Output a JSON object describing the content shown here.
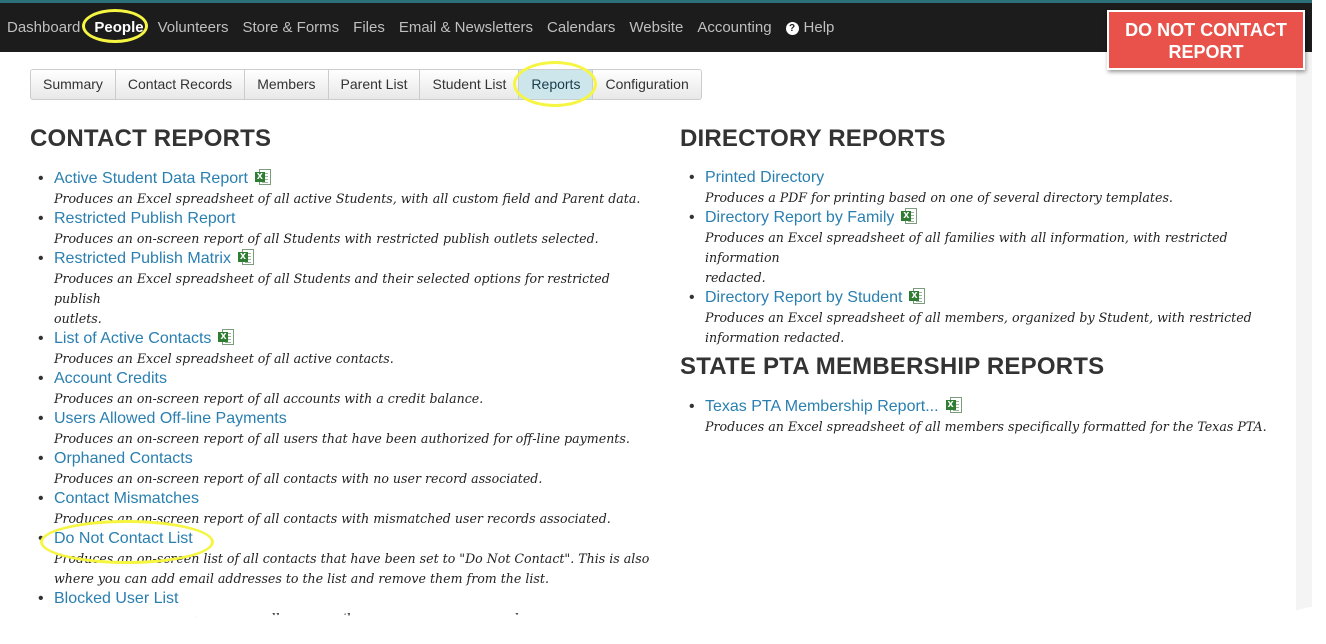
{
  "callout": {
    "line1": "DO NOT CONTACT",
    "line2": "REPORT"
  },
  "top_nav": [
    {
      "label": "Dashboard"
    },
    {
      "label": "People",
      "active": true
    },
    {
      "label": "Volunteers"
    },
    {
      "label": "Store & Forms"
    },
    {
      "label": "Files"
    },
    {
      "label": "Email & Newsletters"
    },
    {
      "label": "Calendars"
    },
    {
      "label": "Website"
    },
    {
      "label": "Accounting"
    },
    {
      "label": "Help",
      "icon": "question-circle-icon"
    }
  ],
  "tabs": [
    {
      "label": "Summary"
    },
    {
      "label": "Contact Records"
    },
    {
      "label": "Members"
    },
    {
      "label": "Parent List"
    },
    {
      "label": "Student List"
    },
    {
      "label": "Reports",
      "active": true
    },
    {
      "label": "Configuration"
    }
  ],
  "contact_reports": {
    "heading": "CONTACT REPORTS",
    "items": [
      {
        "label": "Active Student Data Report",
        "excel": true,
        "desc": [
          "Produces an Excel spreadsheet of all active Students, with all custom field and Parent data."
        ]
      },
      {
        "label": "Restricted Publish Report",
        "excel": false,
        "desc": [
          "Produces an on-screen report of all Students with restricted publish outlets selected."
        ]
      },
      {
        "label": "Restricted Publish Matrix",
        "excel": true,
        "desc": [
          "Produces an Excel spreadsheet of all Students and their selected options for restricted publish",
          "outlets."
        ]
      },
      {
        "label": "List of Active Contacts",
        "excel": true,
        "desc": [
          "Produces an Excel spreadsheet of all active contacts."
        ]
      },
      {
        "label": "Account Credits",
        "excel": false,
        "desc": [
          "Produces an on-screen report of all accounts with a credit balance."
        ]
      },
      {
        "label": "Users Allowed Off-line Payments",
        "excel": false,
        "desc": [
          "Produces an on-screen report of all users that have been authorized for off-line payments."
        ]
      },
      {
        "label": "Orphaned Contacts",
        "excel": false,
        "desc": [
          "Produces an on-screen report of all contacts with no user record associated."
        ]
      },
      {
        "label": "Contact Mismatches",
        "excel": false,
        "desc": [
          "Produces an on-screen report of all contacts with mismatched user records associated."
        ]
      },
      {
        "label": "Do Not Contact List",
        "excel": false,
        "highlight": true,
        "desc": [
          "Produces an on-screen list of all contacts that have been set to \"Do Not Contact\". This is also",
          "where you can add email addresses to the list and remove them from the list."
        ]
      },
      {
        "label": "Blocked User List",
        "excel": false,
        "desc": [
          "Produces an on-screen report of all user email accounts that have been blocked from logging"
        ]
      }
    ]
  },
  "directory_reports": {
    "heading": "DIRECTORY REPORTS",
    "items": [
      {
        "label": "Printed Directory",
        "excel": false,
        "desc": [
          "Produces a PDF for printing based on one of several directory templates."
        ]
      },
      {
        "label": "Directory Report by Family",
        "excel": true,
        "desc": [
          "Produces an Excel spreadsheet of all families with all information, with restricted information",
          "redacted."
        ]
      },
      {
        "label": "Directory Report by Student",
        "excel": true,
        "desc": [
          "Produces an Excel spreadsheet of all members, organized by Student, with restricted",
          "information redacted."
        ]
      }
    ]
  },
  "state_pta_reports": {
    "heading": "STATE PTA MEMBERSHIP REPORTS",
    "items": [
      {
        "label": "Texas PTA Membership Report...",
        "excel": true,
        "desc": [
          "Produces an Excel spreadsheet of all members specifically formatted for the Texas PTA."
        ]
      }
    ]
  },
  "excel_icon_letter": "X",
  "help_icon_glyph": "?"
}
